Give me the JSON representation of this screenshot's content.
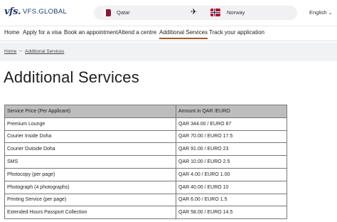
{
  "header": {
    "logo_mark": "vfs.",
    "logo_text": "VFS.GLOBAL",
    "route": {
      "origin": "Qatar",
      "destination": "Norway"
    },
    "language": "English"
  },
  "nav": {
    "items": [
      {
        "label": "Home"
      },
      {
        "label": "Apply for a visa"
      },
      {
        "label": "Book an appointment"
      },
      {
        "label": "Attend a centre"
      },
      {
        "label": "Additional Services",
        "active": true
      },
      {
        "label": "Track your application"
      }
    ]
  },
  "breadcrumb": {
    "home": "Home",
    "separator": "→",
    "current": "Additional Services"
  },
  "page": {
    "title": "Additional Services"
  },
  "table": {
    "headers": [
      "Service Price (Per Applicant)",
      "Amount in QAR /EURO"
    ],
    "rows": [
      [
        "Premium Lounge",
        "QAR 344.00 / EURO 87"
      ],
      [
        "Courier Inside Doha",
        "QAR 70.00 / EURO 17.5"
      ],
      [
        "Courier Outside Doha",
        "QAR 91.00 / EURO 23"
      ],
      [
        "SMS",
        "QAR 10.00 / EURO 2.5"
      ],
      [
        "Photocopy (per page)",
        "QAR 4.00 / EURO 1.00"
      ],
      [
        "Photograph (4 photographs)",
        "QAR 40.00 / EURO 10"
      ],
      [
        "Printing Service (per page)",
        "QAR 6.00 / EURO 1.5"
      ],
      [
        "Extended Hours Passport Collection",
        "QAR 58.00 / EURO 14.5"
      ]
    ]
  },
  "icons": {
    "plane": "airplane-icon",
    "chevron": "chevron-down-icon",
    "flag_origin": "qatar-flag-icon",
    "flag_destination": "norway-flag-icon"
  },
  "colors": {
    "brand": "#1f3b70",
    "active_underline": "#a15c2b",
    "table_header_bg": "#bdbdbd",
    "breadcrumb_bg": "#f1f2f4"
  }
}
